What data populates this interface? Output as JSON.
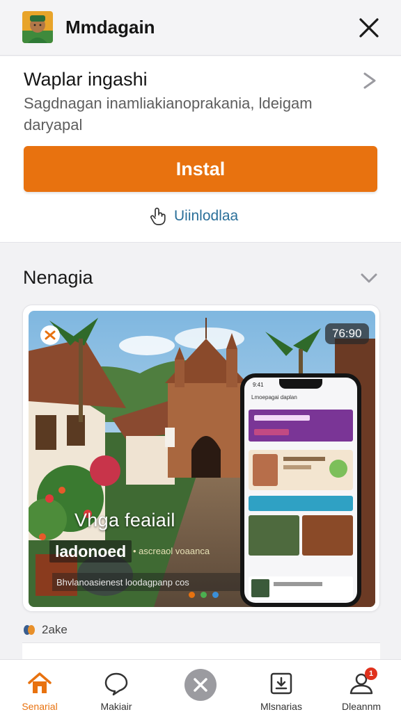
{
  "header": {
    "app_name": "Mmdagain",
    "app_icon": "app-avatar-icon",
    "close_icon": "close-icon"
  },
  "install_card": {
    "title": "Waplar ingashi",
    "description": "Sagdnagan inamliakianoprakania, ldeigam daryapal",
    "install_label": "Instal",
    "secondary_label": "Uiinlodlaa",
    "secondary_icon": "hand-pointer-icon",
    "colors": {
      "accent": "#e8720f",
      "link": "#2a6f99"
    }
  },
  "section": {
    "title": "Nenagia",
    "chevron_icon": "chevron-down-icon"
  },
  "feature": {
    "time_badge": "76:90",
    "overlay_title": "Vhga feaiail",
    "overlay_logo": "ladonoed",
    "overlay_meta": "• ascreaol voaanca",
    "overlay_sub": "Bhvlanoasienest loodagpanp cos",
    "carousel_dot_colors": [
      "#e8720f",
      "#4caf50",
      "#3b8fd8"
    ],
    "phone": {
      "status": "9:41",
      "header_text": "Lmoepagai daplan"
    }
  },
  "sub_line": {
    "text": "2ake"
  },
  "bottom_nav": {
    "items": [
      {
        "label": "Senarial",
        "icon": "home-icon",
        "active": true
      },
      {
        "label": "Makiair",
        "icon": "chat-bubble-icon",
        "active": false
      },
      {
        "label": "",
        "icon": "tools-icon",
        "active": false
      },
      {
        "label": "Mlsnarias",
        "icon": "download-box-icon",
        "active": false
      },
      {
        "label": "Dleannm",
        "icon": "profile-icon",
        "active": false
      }
    ],
    "notification_count": "1"
  }
}
